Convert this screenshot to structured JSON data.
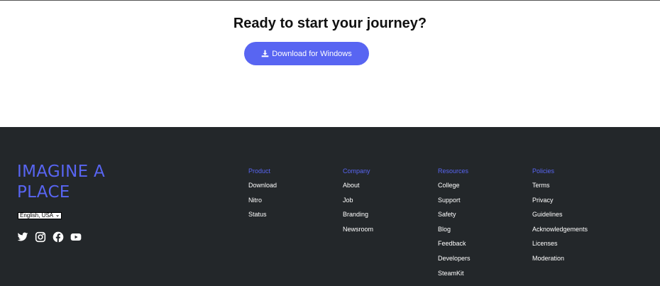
{
  "hero": {
    "headline": "Ready to start your journey?",
    "download_label": "Download for Windows",
    "download_icon": "download-icon",
    "accent": "#5865f2"
  },
  "footer": {
    "brand": "IMAGINE A PLACE",
    "language": "English, USA",
    "background": "#23272a",
    "socials": [
      "twitter-icon",
      "instagram-icon",
      "facebook-icon",
      "youtube-icon"
    ],
    "columns": [
      {
        "title": "Product",
        "links": [
          "Download",
          "Nitro",
          "Status"
        ]
      },
      {
        "title": "Company",
        "links": [
          "About",
          "Job",
          "Branding",
          "Newsroom"
        ]
      },
      {
        "title": "Resources",
        "links": [
          "College",
          "Support",
          "Safety",
          "Blog",
          "Feedback",
          "Developers",
          "SteamKit"
        ]
      },
      {
        "title": "Policies",
        "links": [
          "Terms",
          "Privacy",
          "Guidelines",
          "Acknowledgements",
          "Licenses",
          "Moderation"
        ]
      }
    ]
  }
}
